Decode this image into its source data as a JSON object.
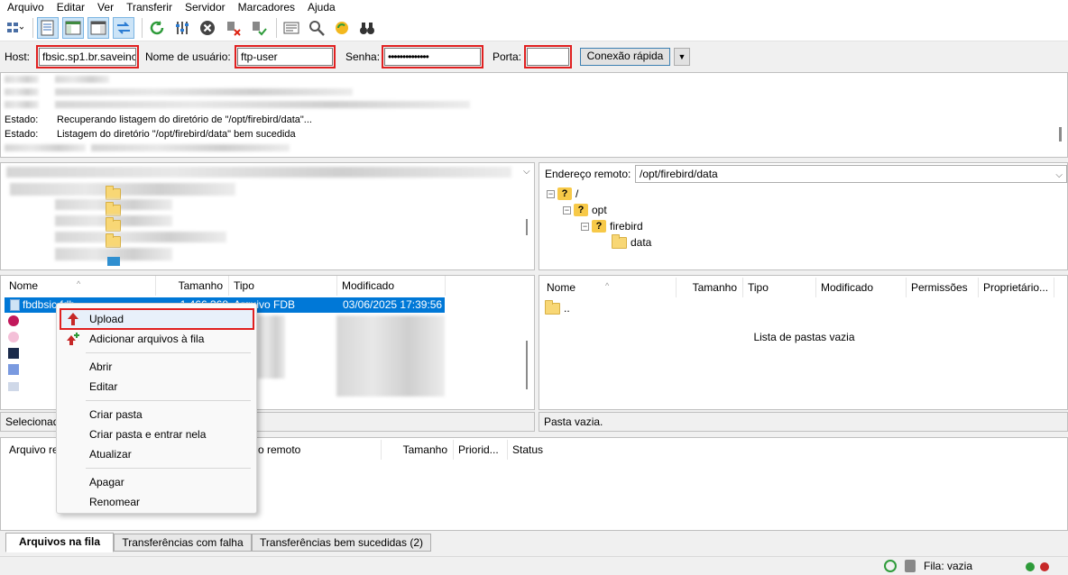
{
  "menu": [
    "Arquivo",
    "Editar",
    "Ver",
    "Transferir",
    "Servidor",
    "Marcadores",
    "Ajuda"
  ],
  "quickconnect": {
    "host_label": "Host:",
    "host_value": "fbsic.sp1.br.saveinc",
    "user_label": "Nome de usuário:",
    "user_value": "ftp-user",
    "pass_label": "Senha:",
    "pass_value": "••••••••••••••",
    "port_label": "Porta:",
    "port_value": "",
    "connect_button": "Conexão rápida"
  },
  "log": [
    {
      "label": "Estado:",
      "text": "Recuperando listagem do diretório de \"/opt/firebird/data\"..."
    },
    {
      "label": "Estado:",
      "text": "Listagem do diretório \"/opt/firebird/data\" bem sucedida"
    }
  ],
  "remote": {
    "path_label": "Endereço remoto:",
    "path_value": "/opt/firebird/data",
    "tree": [
      {
        "name": "/"
      },
      {
        "name": "opt"
      },
      {
        "name": "firebird"
      },
      {
        "name": "data"
      }
    ],
    "columns": [
      "Nome",
      "Tamanho",
      "Tipo",
      "Modificado",
      "Permissões",
      "Proprietário..."
    ],
    "parent_entry": "..",
    "empty_text": "Lista de pastas vazia",
    "status": "Pasta vazia."
  },
  "local": {
    "columns": [
      "Nome",
      "Tamanho",
      "Tipo",
      "Modificado"
    ],
    "selected_file": {
      "name": "fbdbsic.fdb",
      "size": "1.466.368",
      "type": "Arquivo FDB",
      "modified": "03/06/2025 17:39:56"
    },
    "status": "Selecionad"
  },
  "context_menu": {
    "items": [
      "Upload",
      "Adicionar arquivos à fila",
      "Abrir",
      "Editar",
      "Criar pasta",
      "Criar pasta e entrar nela",
      "Atualizar",
      "Apagar",
      "Renomear"
    ]
  },
  "queue": {
    "columns": [
      "Arquivo re",
      "o remoto",
      "Tamanho",
      "Priorid...",
      "Status"
    ]
  },
  "tabs": [
    "Arquivos na fila",
    "Transferências com falha",
    "Transferências bem sucedidas (2)"
  ],
  "statusbar": {
    "queue_text": "Fila: vazia"
  },
  "colors": {
    "highlight": "#e02020",
    "selection": "#0078d7"
  }
}
